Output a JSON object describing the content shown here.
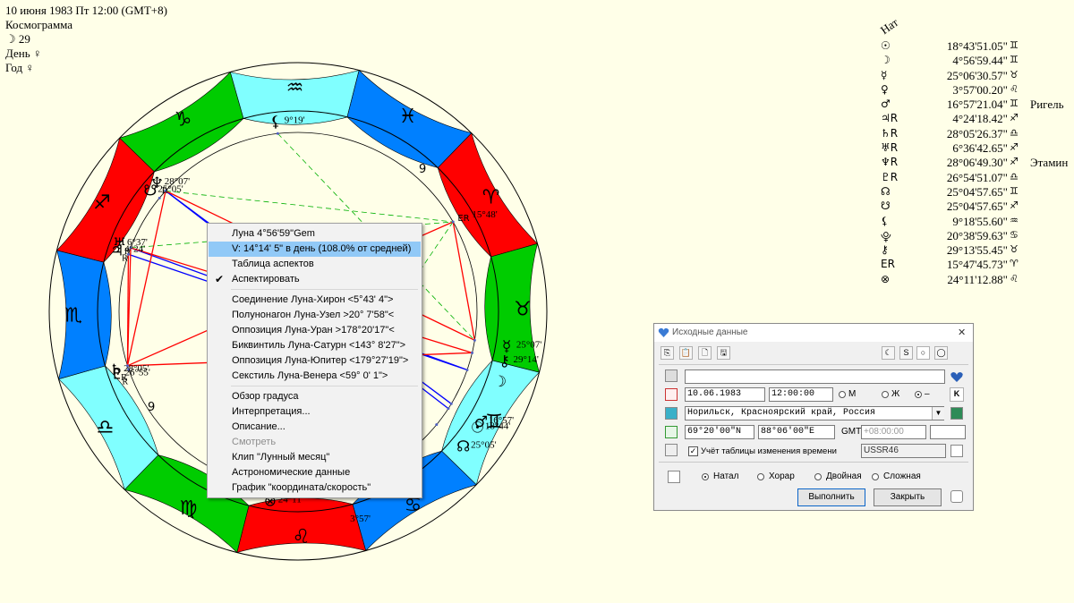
{
  "header": {
    "datetime": "10 июня 1983  Пт  12:00 (GMT+8)",
    "chart_type": "Космограмма",
    "moon_day_symbol": "☽",
    "moon_day": "29",
    "day_label": "День ♀",
    "year_label": "Год ♀"
  },
  "colors": {
    "fire": "#ff0000",
    "earth": "#00cc00",
    "air": "#80ffff",
    "water": "#0080ff",
    "aspect_red": "#ff0000",
    "aspect_blue": "#0000ff",
    "aspect_green": "#00b000",
    "background": "#ffffe8",
    "menu_highlight": "#91c9f7"
  },
  "wheel": {
    "asc_longitude": 225.8,
    "signs": [
      {
        "index": 0,
        "glyph": "♈",
        "element": "fire"
      },
      {
        "index": 1,
        "glyph": "♉",
        "element": "earth"
      },
      {
        "index": 2,
        "glyph": "♊",
        "element": "air"
      },
      {
        "index": 3,
        "glyph": "♋",
        "element": "water"
      },
      {
        "index": 4,
        "glyph": "♌",
        "element": "fire"
      },
      {
        "index": 5,
        "glyph": "♍",
        "element": "earth"
      },
      {
        "index": 6,
        "glyph": "♎",
        "element": "air"
      },
      {
        "index": 7,
        "glyph": "♏",
        "element": "water"
      },
      {
        "index": 8,
        "glyph": "♐",
        "element": "fire"
      },
      {
        "index": 9,
        "glyph": "♑",
        "element": "earth"
      },
      {
        "index": 10,
        "glyph": "♒",
        "element": "air"
      },
      {
        "index": 11,
        "glyph": "♓",
        "element": "water"
      }
    ],
    "planets": [
      {
        "name": "sun",
        "glyph": "☉",
        "degree": "18°44'",
        "longitude": 78.7
      },
      {
        "name": "moon",
        "glyph": "☽",
        "degree": "",
        "longitude": 64.9
      },
      {
        "name": "mercury",
        "glyph": "☿",
        "degree": "25°07'",
        "longitude": 55.1
      },
      {
        "name": "mars",
        "glyph": "♂",
        "degree": "16°57'",
        "longitude": 76.9
      },
      {
        "name": "node",
        "glyph": "☊",
        "degree": "25°05'",
        "longitude": 85.1
      },
      {
        "name": "chiron",
        "glyph": "⚷",
        "degree": "29°14'",
        "longitude": 59.2
      },
      {
        "name": "uranus",
        "glyph": "♅",
        "degree": "6°37'",
        "longitude": 246.6,
        "retro": "R"
      },
      {
        "name": "jupiter",
        "glyph": "♃",
        "degree": "4°24'",
        "longitude": 244.4,
        "retro": "R"
      },
      {
        "name": "neptune",
        "glyph": "♆",
        "degree": "28°07'",
        "longitude": 268.1,
        "retro": "R"
      },
      {
        "name": "south_node",
        "glyph": "☋",
        "degree": "25°05'",
        "longitude": 265.1
      },
      {
        "name": "pluto",
        "glyph": "♇",
        "degree": "26°55'",
        "longitude": 206.9,
        "retro": "R"
      },
      {
        "name": "saturn",
        "glyph": "♄",
        "degree": "28°05'",
        "longitude": 208.1,
        "retro": "R"
      },
      {
        "name": "lilith",
        "glyph": "⚸",
        "degree": "9°19'",
        "longitude": 309.3
      },
      {
        "name": "er",
        "glyph": "ER",
        "degree": "15°48'",
        "longitude": 15.8
      },
      {
        "name": "fortune",
        "glyph": "⊗",
        "degree": "24°11'",
        "longitude": 144.2
      },
      {
        "name": "leo_point",
        "glyph": "",
        "degree": "3°57'",
        "longitude": 123.9
      }
    ],
    "house_label_9": "9",
    "house_label_9b": "9"
  },
  "planet_table": {
    "title": "Нат",
    "rows": [
      {
        "sym": "☉",
        "pos": "18°43'51.05\"",
        "sign": "♊",
        "star": ""
      },
      {
        "sym": "☽",
        "pos": "4°56'59.44\"",
        "sign": "♊",
        "star": ""
      },
      {
        "sym": "☿",
        "pos": "25°06'30.57\"",
        "sign": "♉",
        "star": ""
      },
      {
        "sym": "♀",
        "pos": "3°57'00.20\"",
        "sign": "♌",
        "star": ""
      },
      {
        "sym": "♂",
        "pos": "16°57'21.04\"",
        "sign": "♊",
        "star": "Ригель"
      },
      {
        "sym": "♃R",
        "pos": "4°24'18.42\"",
        "sign": "♐",
        "star": ""
      },
      {
        "sym": "♄R",
        "pos": "28°05'26.37\"",
        "sign": "♎",
        "star": ""
      },
      {
        "sym": "♅R",
        "pos": "6°36'42.65\"",
        "sign": "♐",
        "star": ""
      },
      {
        "sym": "♆R",
        "pos": "28°06'49.30\"",
        "sign": "♐",
        "star": "Этамин"
      },
      {
        "sym": "♇R",
        "pos": "26°54'51.07\"",
        "sign": "♎",
        "star": ""
      },
      {
        "sym": "☊",
        "pos": "25°04'57.65\"",
        "sign": "♊",
        "star": ""
      },
      {
        "sym": "☋",
        "pos": "25°04'57.65\"",
        "sign": "♐",
        "star": ""
      },
      {
        "sym": "⚸",
        "pos": "9°18'55.60\"",
        "sign": "♒",
        "star": ""
      },
      {
        "sym": "⯓",
        "pos": "20°38'59.63\"",
        "sign": "♋",
        "star": ""
      },
      {
        "sym": "⚷",
        "pos": "29°13'55.45\"",
        "sign": "♉",
        "star": ""
      },
      {
        "sym": "ER",
        "pos": "15°47'45.73\"",
        "sign": "♈",
        "star": ""
      },
      {
        "sym": "⊗",
        "pos": "24°11'12.88\"",
        "sign": "♌",
        "star": ""
      }
    ]
  },
  "context_menu": {
    "items": [
      {
        "label": "Луна   4°56'59\"Gem",
        "state": "normal"
      },
      {
        "label": "V: 14°14' 5\" в день  (108.0% от средней)",
        "state": "highlight"
      },
      {
        "label": "Таблица аспектов",
        "state": "normal"
      },
      {
        "label": "Аспектировать",
        "state": "checked"
      },
      {
        "label": "Соединение Луна-Хирон  <5°43' 4\">",
        "state": "normal"
      },
      {
        "label": "Полунонагон Луна-Узел  >20° 7'58\"<",
        "state": "normal"
      },
      {
        "label": "Оппозиция Луна-Уран  >178°20'17\"<",
        "state": "normal"
      },
      {
        "label": "Биквинтиль Луна-Сатурн  <143° 8'27\">",
        "state": "normal"
      },
      {
        "label": "Оппозиция Луна-Юпитер  <179°27'19\">",
        "state": "normal"
      },
      {
        "label": "Секстиль Луна-Венера  <59° 0' 1\">",
        "state": "normal"
      },
      {
        "label": "Обзор градуса",
        "state": "normal"
      },
      {
        "label": "Интерпретация...",
        "state": "normal"
      },
      {
        "label": "Описание...",
        "state": "normal"
      },
      {
        "label": "Смотреть",
        "state": "disabled"
      },
      {
        "label": "Клип \"Лунный месяц\"",
        "state": "normal"
      },
      {
        "label": "Астрономические данные",
        "state": "normal"
      },
      {
        "label": "График \"координата/скорость\"",
        "state": "normal"
      }
    ],
    "check_glyph": "✔"
  },
  "dialog": {
    "title": "Исходные данные",
    "close_glyph": "✕",
    "name_value": "",
    "date_value": "10.06.1983",
    "time_value": "12:00:00",
    "sex_m": "М",
    "sex_f": "Ж",
    "sex_none": "–",
    "k_button": "K",
    "place_value": "Норильск, Красноярский край, Россия",
    "lat_value": "69°20'00\"N",
    "lon_value": "88°06'00\"E",
    "gmt_label": "GMT",
    "gmt_value": "+08:00:00",
    "tz_check_label": "Учёт таблицы изменения времени",
    "tz_table": "USSR46",
    "modes": {
      "natal": "Натал",
      "horar": "Хорар",
      "double": "Двойная",
      "complex": "Сложная"
    },
    "run_button": "Выполнить",
    "close_button": "Закрыть"
  }
}
